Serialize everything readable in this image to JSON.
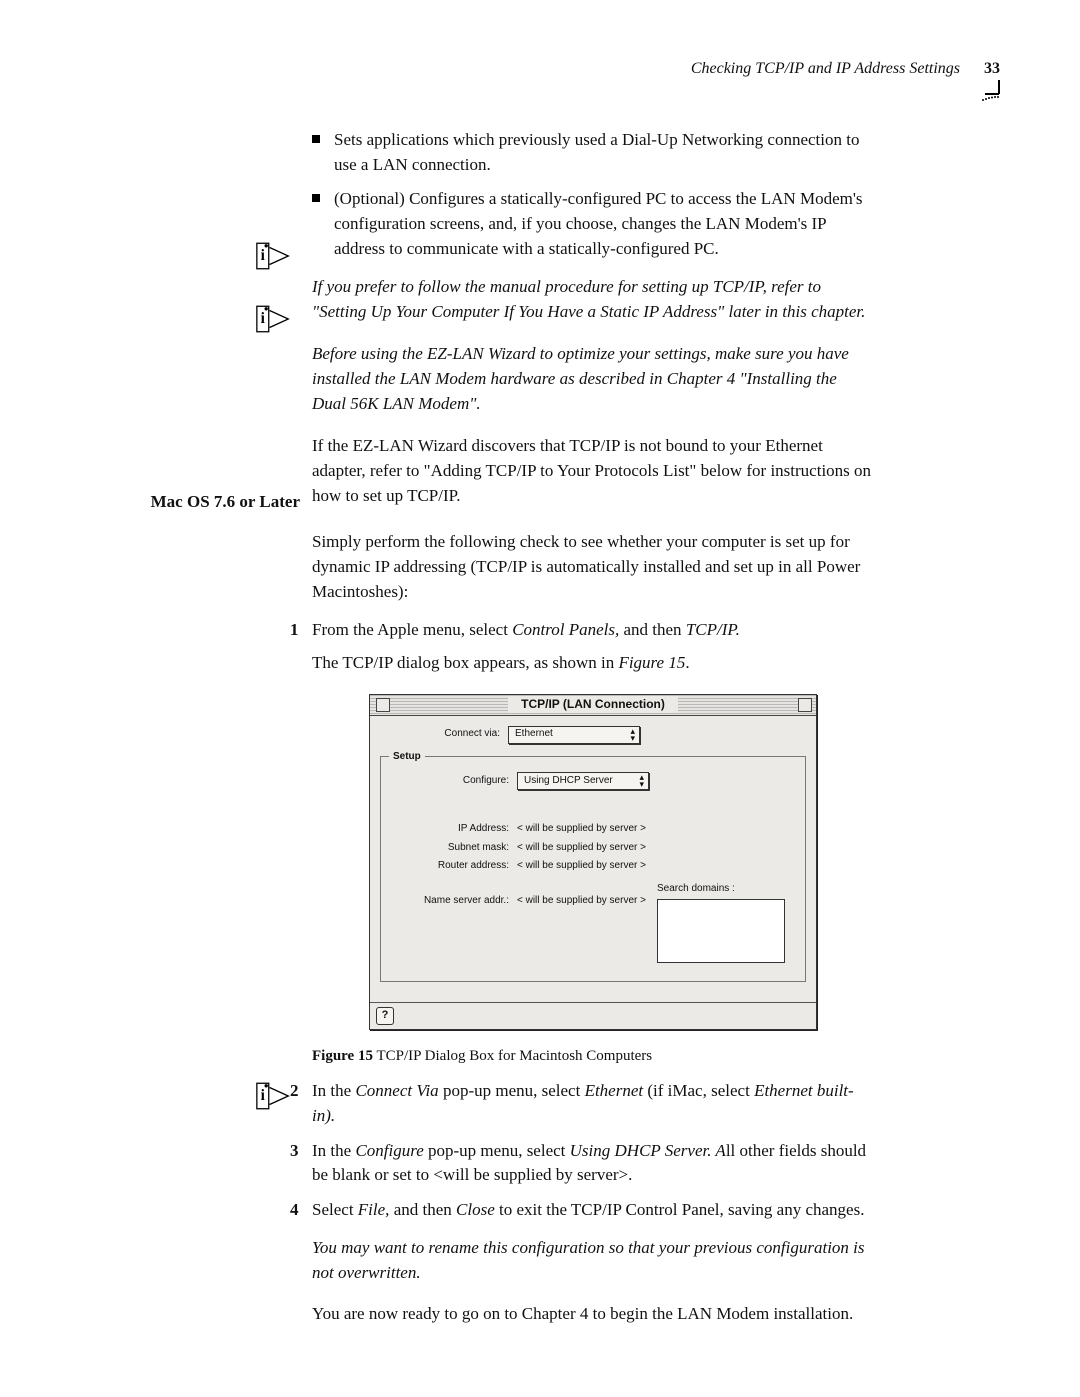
{
  "header": {
    "running_title": "Checking TCP/IP and IP Address Settings",
    "page_number": "33"
  },
  "bullets": [
    "Sets applications which previously used a Dial-Up Networking connection to use a LAN connection.",
    "(Optional) Configures a statically-configured PC to access the LAN Modem's configuration screens, and, if you choose, changes the LAN Modem's IP address to communicate with a statically-configured PC."
  ],
  "info_notes": {
    "note1": "If you prefer to follow the manual procedure for setting up TCP/IP, refer to \"Setting Up Your Computer If You Have a Static IP Address\" later in this chapter.",
    "note2": "Before using the EZ-LAN Wizard to optimize your settings, make sure you have installed the LAN Modem hardware as described in Chapter 4 \"Installing the Dual 56K LAN Modem\".",
    "note3": "You may want to rename this configuration so that your previous configuration is not overwritten."
  },
  "para_ezlan": "If the EZ-LAN Wizard discovers that TCP/IP is not bound to your Ethernet adapter, refer to \"Adding TCP/IP to Your Protocols List\" below for instructions on how to set up TCP/IP.",
  "section_label": "Mac OS 7.6 or Later",
  "mac_intro": "Simply perform the following check to see whether your computer is set up for dynamic IP addressing (TCP/IP is automatically installed and set up in all Power Macintoshes):",
  "steps": {
    "s1_a": "From the Apple menu, select ",
    "s1_i1": "Control Panels,",
    "s1_b": " and then ",
    "s1_i2": "TCP/IP.",
    "s1_after": "The TCP/IP dialog box appears, as shown in ",
    "s1_after_i": "Figure 15",
    "s1_after_end": ".",
    "s2_a": "In the ",
    "s2_i1": "Connect Via",
    "s2_b": " pop-up menu, select ",
    "s2_i2": "Ethernet",
    "s2_c": " (if iMac, select ",
    "s2_i3": "Ethernet built-in).",
    "s3_a": "In the ",
    "s3_i1": "Configure",
    "s3_b": " pop-up menu, select ",
    "s3_i2": "Using DHCP Server. A",
    "s3_c": "ll other fields should be blank or set to <will be supplied by server>.",
    "s4_a": "Select ",
    "s4_i1": "File,",
    "s4_b": " and then ",
    "s4_i2": "Close",
    "s4_c": " to exit the TCP/IP Control Panel, saving any changes."
  },
  "closing": "You are now ready to go on to Chapter 4 to begin the LAN Modem installation.",
  "figure": {
    "label": "Figure 15",
    "caption": "   TCP/IP Dialog Box for Macintosh Computers"
  },
  "dialog": {
    "title": "TCP/IP (LAN Connection)",
    "connect_via_label": "Connect via:",
    "connect_via_value": "Ethernet",
    "setup_legend": "Setup",
    "configure_label": "Configure:",
    "configure_value": "Using DHCP Server",
    "ip_label": "IP Address:",
    "ip_value": "< will be supplied by server >",
    "subnet_label": "Subnet mask:",
    "subnet_value": "< will be supplied by server >",
    "router_label": "Router address:",
    "router_value": "< will be supplied by server >",
    "ns_label": "Name server addr.:",
    "ns_value": "< will be supplied by server >",
    "search_label": "Search domains :",
    "help": "?"
  }
}
